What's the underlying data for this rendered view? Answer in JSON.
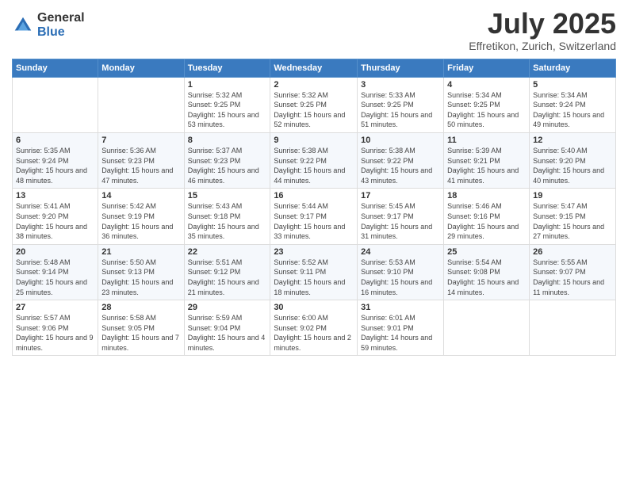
{
  "logo": {
    "general": "General",
    "blue": "Blue"
  },
  "header": {
    "title": "July 2025",
    "subtitle": "Effretikon, Zurich, Switzerland"
  },
  "days_of_week": [
    "Sunday",
    "Monday",
    "Tuesday",
    "Wednesday",
    "Thursday",
    "Friday",
    "Saturday"
  ],
  "weeks": [
    [
      {
        "day": "",
        "sunrise": "",
        "sunset": "",
        "daylight": ""
      },
      {
        "day": "",
        "sunrise": "",
        "sunset": "",
        "daylight": ""
      },
      {
        "day": "1",
        "sunrise": "Sunrise: 5:32 AM",
        "sunset": "Sunset: 9:25 PM",
        "daylight": "Daylight: 15 hours and 53 minutes."
      },
      {
        "day": "2",
        "sunrise": "Sunrise: 5:32 AM",
        "sunset": "Sunset: 9:25 PM",
        "daylight": "Daylight: 15 hours and 52 minutes."
      },
      {
        "day": "3",
        "sunrise": "Sunrise: 5:33 AM",
        "sunset": "Sunset: 9:25 PM",
        "daylight": "Daylight: 15 hours and 51 minutes."
      },
      {
        "day": "4",
        "sunrise": "Sunrise: 5:34 AM",
        "sunset": "Sunset: 9:25 PM",
        "daylight": "Daylight: 15 hours and 50 minutes."
      },
      {
        "day": "5",
        "sunrise": "Sunrise: 5:34 AM",
        "sunset": "Sunset: 9:24 PM",
        "daylight": "Daylight: 15 hours and 49 minutes."
      }
    ],
    [
      {
        "day": "6",
        "sunrise": "Sunrise: 5:35 AM",
        "sunset": "Sunset: 9:24 PM",
        "daylight": "Daylight: 15 hours and 48 minutes."
      },
      {
        "day": "7",
        "sunrise": "Sunrise: 5:36 AM",
        "sunset": "Sunset: 9:23 PM",
        "daylight": "Daylight: 15 hours and 47 minutes."
      },
      {
        "day": "8",
        "sunrise": "Sunrise: 5:37 AM",
        "sunset": "Sunset: 9:23 PM",
        "daylight": "Daylight: 15 hours and 46 minutes."
      },
      {
        "day": "9",
        "sunrise": "Sunrise: 5:38 AM",
        "sunset": "Sunset: 9:22 PM",
        "daylight": "Daylight: 15 hours and 44 minutes."
      },
      {
        "day": "10",
        "sunrise": "Sunrise: 5:38 AM",
        "sunset": "Sunset: 9:22 PM",
        "daylight": "Daylight: 15 hours and 43 minutes."
      },
      {
        "day": "11",
        "sunrise": "Sunrise: 5:39 AM",
        "sunset": "Sunset: 9:21 PM",
        "daylight": "Daylight: 15 hours and 41 minutes."
      },
      {
        "day": "12",
        "sunrise": "Sunrise: 5:40 AM",
        "sunset": "Sunset: 9:20 PM",
        "daylight": "Daylight: 15 hours and 40 minutes."
      }
    ],
    [
      {
        "day": "13",
        "sunrise": "Sunrise: 5:41 AM",
        "sunset": "Sunset: 9:20 PM",
        "daylight": "Daylight: 15 hours and 38 minutes."
      },
      {
        "day": "14",
        "sunrise": "Sunrise: 5:42 AM",
        "sunset": "Sunset: 9:19 PM",
        "daylight": "Daylight: 15 hours and 36 minutes."
      },
      {
        "day": "15",
        "sunrise": "Sunrise: 5:43 AM",
        "sunset": "Sunset: 9:18 PM",
        "daylight": "Daylight: 15 hours and 35 minutes."
      },
      {
        "day": "16",
        "sunrise": "Sunrise: 5:44 AM",
        "sunset": "Sunset: 9:17 PM",
        "daylight": "Daylight: 15 hours and 33 minutes."
      },
      {
        "day": "17",
        "sunrise": "Sunrise: 5:45 AM",
        "sunset": "Sunset: 9:17 PM",
        "daylight": "Daylight: 15 hours and 31 minutes."
      },
      {
        "day": "18",
        "sunrise": "Sunrise: 5:46 AM",
        "sunset": "Sunset: 9:16 PM",
        "daylight": "Daylight: 15 hours and 29 minutes."
      },
      {
        "day": "19",
        "sunrise": "Sunrise: 5:47 AM",
        "sunset": "Sunset: 9:15 PM",
        "daylight": "Daylight: 15 hours and 27 minutes."
      }
    ],
    [
      {
        "day": "20",
        "sunrise": "Sunrise: 5:48 AM",
        "sunset": "Sunset: 9:14 PM",
        "daylight": "Daylight: 15 hours and 25 minutes."
      },
      {
        "day": "21",
        "sunrise": "Sunrise: 5:50 AM",
        "sunset": "Sunset: 9:13 PM",
        "daylight": "Daylight: 15 hours and 23 minutes."
      },
      {
        "day": "22",
        "sunrise": "Sunrise: 5:51 AM",
        "sunset": "Sunset: 9:12 PM",
        "daylight": "Daylight: 15 hours and 21 minutes."
      },
      {
        "day": "23",
        "sunrise": "Sunrise: 5:52 AM",
        "sunset": "Sunset: 9:11 PM",
        "daylight": "Daylight: 15 hours and 18 minutes."
      },
      {
        "day": "24",
        "sunrise": "Sunrise: 5:53 AM",
        "sunset": "Sunset: 9:10 PM",
        "daylight": "Daylight: 15 hours and 16 minutes."
      },
      {
        "day": "25",
        "sunrise": "Sunrise: 5:54 AM",
        "sunset": "Sunset: 9:08 PM",
        "daylight": "Daylight: 15 hours and 14 minutes."
      },
      {
        "day": "26",
        "sunrise": "Sunrise: 5:55 AM",
        "sunset": "Sunset: 9:07 PM",
        "daylight": "Daylight: 15 hours and 11 minutes."
      }
    ],
    [
      {
        "day": "27",
        "sunrise": "Sunrise: 5:57 AM",
        "sunset": "Sunset: 9:06 PM",
        "daylight": "Daylight: 15 hours and 9 minutes."
      },
      {
        "day": "28",
        "sunrise": "Sunrise: 5:58 AM",
        "sunset": "Sunset: 9:05 PM",
        "daylight": "Daylight: 15 hours and 7 minutes."
      },
      {
        "day": "29",
        "sunrise": "Sunrise: 5:59 AM",
        "sunset": "Sunset: 9:04 PM",
        "daylight": "Daylight: 15 hours and 4 minutes."
      },
      {
        "day": "30",
        "sunrise": "Sunrise: 6:00 AM",
        "sunset": "Sunset: 9:02 PM",
        "daylight": "Daylight: 15 hours and 2 minutes."
      },
      {
        "day": "31",
        "sunrise": "Sunrise: 6:01 AM",
        "sunset": "Sunset: 9:01 PM",
        "daylight": "Daylight: 14 hours and 59 minutes."
      },
      {
        "day": "",
        "sunrise": "",
        "sunset": "",
        "daylight": ""
      },
      {
        "day": "",
        "sunrise": "",
        "sunset": "",
        "daylight": ""
      }
    ]
  ]
}
